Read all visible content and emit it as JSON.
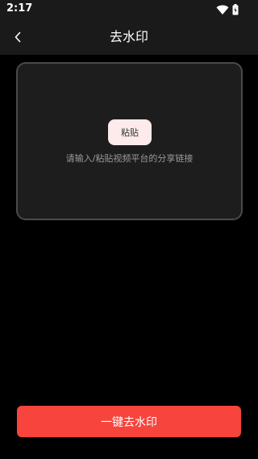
{
  "status_bar": {
    "time": "2:17",
    "icons": [
      "wifi-icon",
      "battery-icon"
    ]
  },
  "header": {
    "back_icon": "chevron-left-icon",
    "title": "去水印"
  },
  "input_card": {
    "paste_label": "粘贴",
    "hint": "请输入/粘贴视频平台的分享链接"
  },
  "action": {
    "label": "一键去水印"
  },
  "colors": {
    "background": "#000000",
    "bar_background": "#1a1a1a",
    "card_background": "#1d1d1d",
    "card_border": "#4a4a4a",
    "paste_button": "#fdeaea",
    "accent": "#f7443c"
  }
}
